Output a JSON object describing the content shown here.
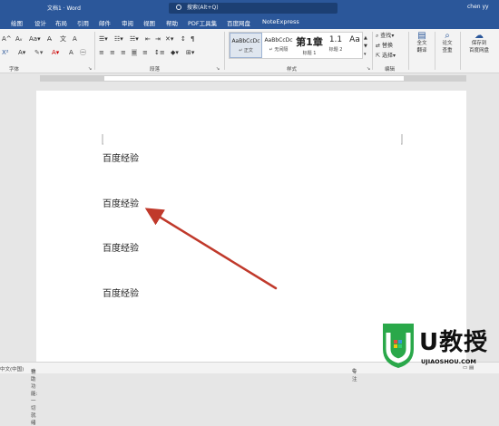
{
  "window": {
    "doc_title": "文档1 · Word",
    "search_placeholder": "搜索(Alt+Q)",
    "user": "chen yy"
  },
  "tabs": [
    "绘图",
    "设计",
    "布局",
    "引用",
    "邮件",
    "审阅",
    "视图",
    "帮助",
    "PDF工具集",
    "百度网盘",
    "NoteExpress"
  ],
  "ribbon": {
    "groups": {
      "font": "字体",
      "paragraph": "段落",
      "styles": "样式",
      "editing": "编辑"
    },
    "styles": [
      {
        "preview": "AaBbCcDc",
        "name": "↵ 正文"
      },
      {
        "preview": "AaBbCcDc",
        "name": "↵ 无间隔"
      },
      {
        "preview": "第1章",
        "name": "标题 1"
      },
      {
        "preview": "1.1",
        "name": "标题 2"
      },
      {
        "preview": "Aa",
        "name": ""
      }
    ],
    "editing": {
      "find": "查找",
      "replace": "替换",
      "select": "选择"
    },
    "translate": "全文\n翻译",
    "check": "论文\n查重",
    "save_baidu": "保存到\n百度网盘"
  },
  "document": {
    "lines": [
      "百度经验",
      "百度经验",
      "百度经验",
      "百度经验"
    ]
  },
  "status": {
    "lang": "中文(中国)",
    "accessibility": "辅助功能: 一切就绪",
    "focus": "专注"
  },
  "watermark": {
    "brand": "U教授",
    "url": "UJIAOSHOU.COM"
  },
  "colors": {
    "title_bar": "#2b579a",
    "arrow": "#c0392b"
  }
}
